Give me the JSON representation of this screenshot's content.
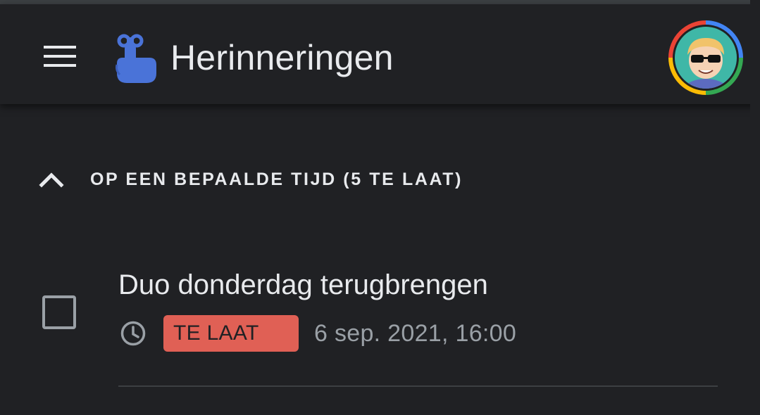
{
  "app": {
    "title": "Herinneringen"
  },
  "icons": {
    "menu": "menu-icon",
    "logo": "reminder-finger-icon",
    "collapse": "chevron-up-icon",
    "clock": "clock-icon",
    "checkbox": "checkbox-icon"
  },
  "colors": {
    "background": "#202124",
    "text": "#e8eaed",
    "muted_text": "#9aa0a6",
    "overdue_badge": "#e06055",
    "logo_blue": "#4a73d8"
  },
  "section": {
    "title": "OP EEN BEPAALDE TIJD (5 TE LAAT)",
    "expanded": true
  },
  "reminders": [
    {
      "title": "Duo donderdag terugbrengen",
      "badge": "TE LAAT",
      "datetime": "6 sep. 2021, 16:00",
      "checked": false
    }
  ]
}
